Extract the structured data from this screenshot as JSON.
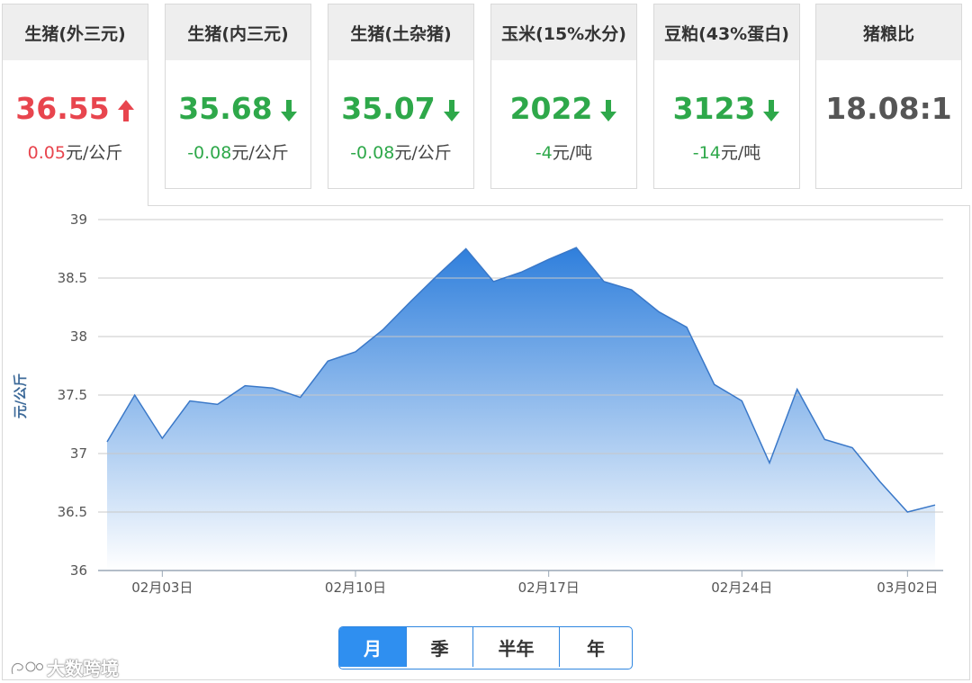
{
  "cards": [
    {
      "name": "生猪(外三元)",
      "price": "36.55",
      "change_num": "0.05",
      "change_unit": "元/公斤",
      "dir": "up",
      "active": true
    },
    {
      "name": "生猪(内三元)",
      "price": "35.68",
      "change_num": "-0.08",
      "change_unit": "元/公斤",
      "dir": "down",
      "active": false
    },
    {
      "name": "生猪(土杂猪)",
      "price": "35.07",
      "change_num": "-0.08",
      "change_unit": "元/公斤",
      "dir": "down",
      "active": false
    },
    {
      "name": "玉米(15%水分)",
      "price": "2022",
      "change_num": "-4",
      "change_unit": "元/吨",
      "dir": "down",
      "active": false
    },
    {
      "name": "豆粕(43%蛋白)",
      "price": "3123",
      "change_num": "-14",
      "change_unit": "元/吨",
      "dir": "down",
      "active": false
    },
    {
      "name": "猪粮比",
      "price": "18.08:1",
      "change_num": "",
      "change_unit": "",
      "dir": "none",
      "active": false
    }
  ],
  "colors": {
    "up": "#e8454e",
    "down": "#2ea84a",
    "area_top": "#2f7fdc",
    "area_bottom": "#ffffff",
    "line": "#3a78c8",
    "accent": "#2f8ff0"
  },
  "chart_data": {
    "type": "area",
    "ylabel": "元/公斤",
    "ylim": [
      36,
      39
    ],
    "yticks": [
      36,
      36.5,
      37,
      37.5,
      38,
      38.5,
      39
    ],
    "grid": true,
    "x": [
      "02-01",
      "02-02",
      "02-03",
      "02-04",
      "02-05",
      "02-06",
      "02-07",
      "02-08",
      "02-09",
      "02-10",
      "02-11",
      "02-12",
      "02-13",
      "02-14",
      "02-15",
      "02-16",
      "02-17",
      "02-18",
      "02-19",
      "02-20",
      "02-21",
      "02-22",
      "02-23",
      "02-24",
      "02-25",
      "02-26",
      "02-27",
      "02-28",
      "03-01",
      "03-02"
    ],
    "values": [
      37.1,
      37.5,
      37.13,
      37.45,
      37.42,
      37.58,
      37.56,
      37.48,
      37.79,
      37.87,
      38.06,
      38.3,
      38.53,
      38.75,
      38.47,
      38.55,
      38.66,
      38.76,
      38.47,
      38.4,
      38.21,
      38.08,
      37.59,
      37.45,
      36.92,
      37.55,
      37.12,
      37.05,
      36.76,
      36.5,
      36.56
    ],
    "xtick_labels": [
      {
        "at": "02-03",
        "label": "02月03日"
      },
      {
        "at": "02-10",
        "label": "02月10日"
      },
      {
        "at": "02-17",
        "label": "02月17日"
      },
      {
        "at": "02-24",
        "label": "02月24日"
      },
      {
        "at": "03-02",
        "label": "03月02日"
      }
    ]
  },
  "range_buttons": [
    {
      "label": "月",
      "selected": true
    },
    {
      "label": "季",
      "selected": false
    },
    {
      "label": "半年",
      "selected": false
    },
    {
      "label": "年",
      "selected": false
    }
  ],
  "watermark": "大数跨境"
}
